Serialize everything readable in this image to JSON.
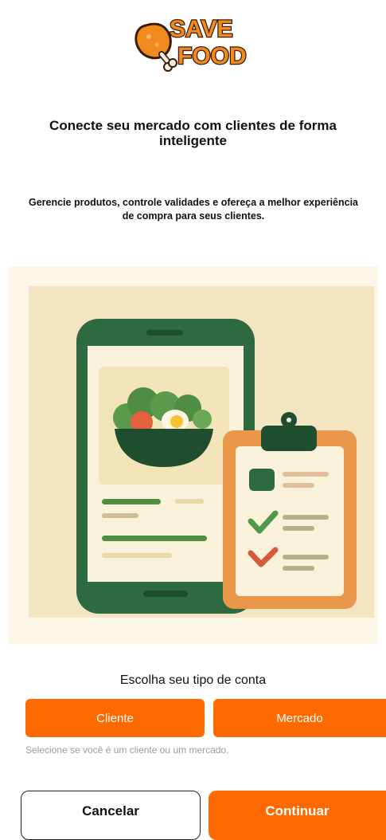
{
  "brand": {
    "line1": "SAVE",
    "line2": "FOOD"
  },
  "header": {
    "title": "Conecte seu mercado com clientes de forma inteligente",
    "subtitle": "Gerencie produtos, controle validades e ofereça a melhor experiência de compra para seus clientes."
  },
  "account": {
    "prompt": "Escolha seu tipo de conta",
    "options": [
      {
        "label": "Cliente"
      },
      {
        "label": "Mercado"
      }
    ],
    "hint": "Selecione se você é um cliente ou um mercado."
  },
  "actions": {
    "cancel_label": "Cancelar",
    "continue_label": "Continuar"
  },
  "colors": {
    "accent": "#ff6a00",
    "illustration_bg": "#fbf6e5",
    "phone_green": "#2d6a3f",
    "clipboard_orange": "#e9974a"
  }
}
